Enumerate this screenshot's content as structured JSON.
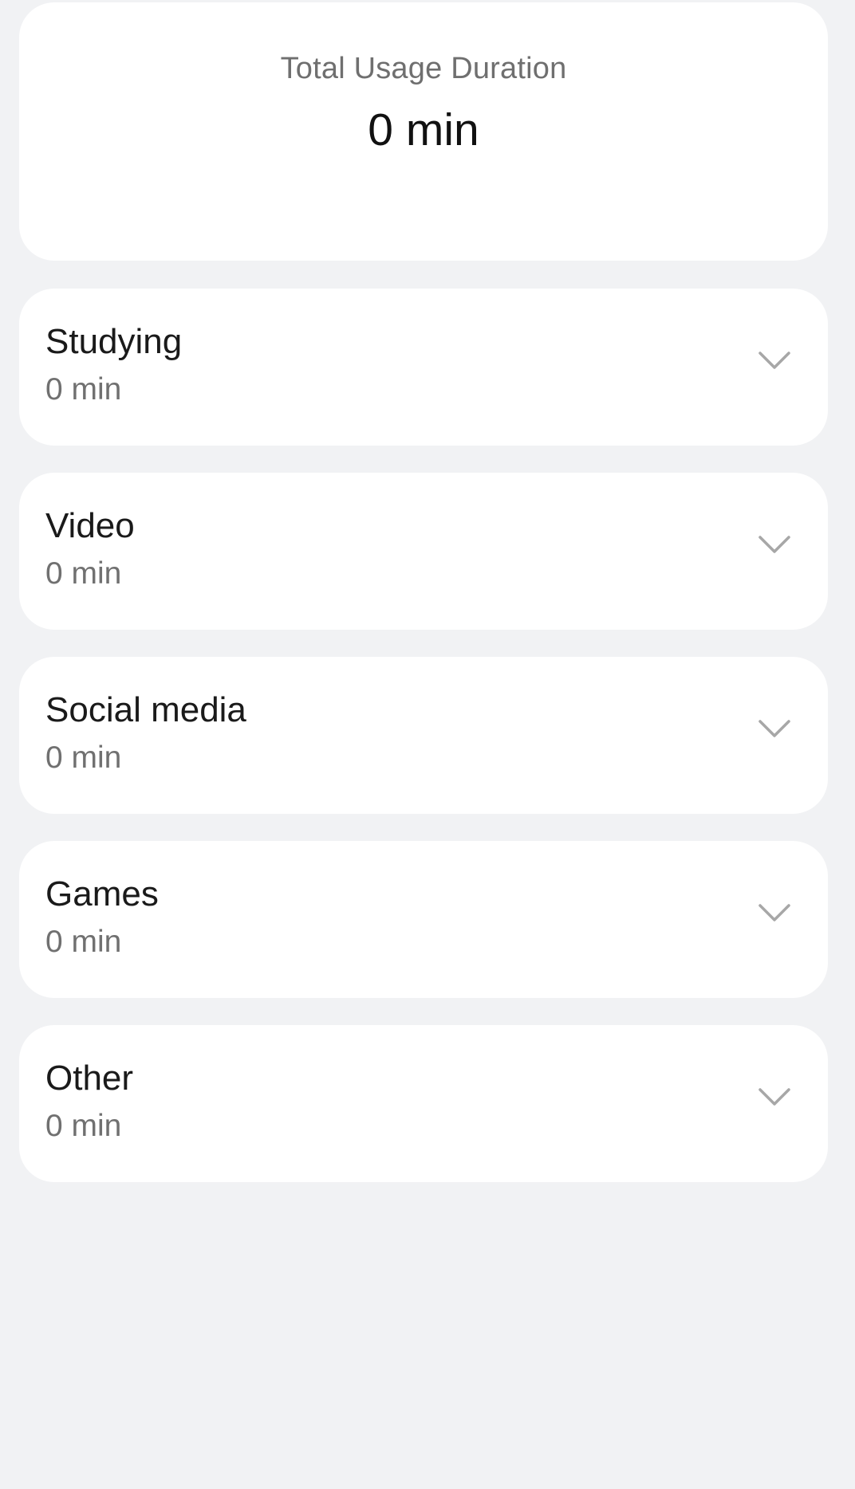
{
  "summary": {
    "title": "Total Usage Duration",
    "value": "0 min"
  },
  "categories": [
    {
      "name": "Studying",
      "value": "0 min",
      "icon": "chevron-down-icon"
    },
    {
      "name": "Video",
      "value": "0 min",
      "icon": "chevron-down-icon"
    },
    {
      "name": "Social media",
      "value": "0 min",
      "icon": "chevron-down-icon"
    },
    {
      "name": "Games",
      "value": "0 min",
      "icon": "chevron-down-icon"
    },
    {
      "name": "Other",
      "value": "0 min",
      "icon": "chevron-down-icon"
    }
  ],
  "colors": {
    "background": "#f1f2f4",
    "card": "#ffffff",
    "primary_text": "#111111",
    "secondary_text": "#707070",
    "chevron": "#a7a7a7"
  }
}
